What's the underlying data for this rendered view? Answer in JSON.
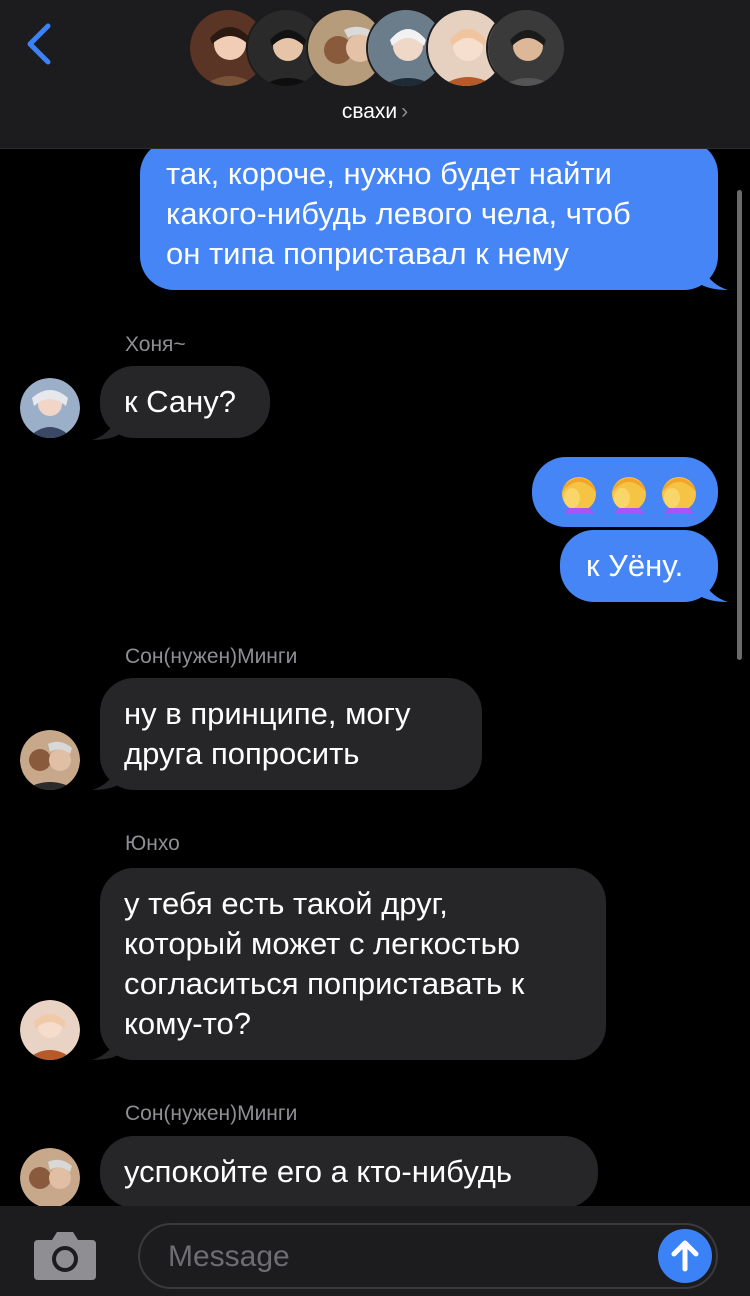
{
  "header": {
    "group_name": "свахи",
    "chevron": "›",
    "colors": {
      "background": "#1c1c1e",
      "accent": "#3b82f6"
    }
  },
  "messages": [
    {
      "type": "outgoing",
      "text_lines": [
        "так, короче, нужно будет найти",
        "какого-нибудь левого чела, чтоб",
        "он типа поприставал к нему"
      ]
    },
    {
      "type": "incoming",
      "sender": "Хоня~",
      "text_lines": [
        "к Сану?"
      ]
    },
    {
      "type": "outgoing_emoji",
      "emoji_name": "facepalm-emoji",
      "count": 3
    },
    {
      "type": "outgoing",
      "text_lines": [
        "к Уёну."
      ]
    },
    {
      "type": "incoming",
      "sender": "Сон(нужен)Минги",
      "text_lines": [
        "ну в принципе, могу",
        "друга попросить"
      ]
    },
    {
      "type": "incoming",
      "sender": "Юнхо",
      "text_lines": [
        "у тебя есть такой друг,",
        "который может с легкостью",
        "согласиться поприставать к",
        "кому-то?"
      ]
    },
    {
      "type": "incoming",
      "sender": "Сон(нужен)Минги",
      "text_lines": [
        "успокойте его а кто-нибудь"
      ]
    }
  ],
  "composer": {
    "placeholder": "Message",
    "camera_icon": "camera-icon",
    "send_icon": "send-arrow-icon"
  }
}
